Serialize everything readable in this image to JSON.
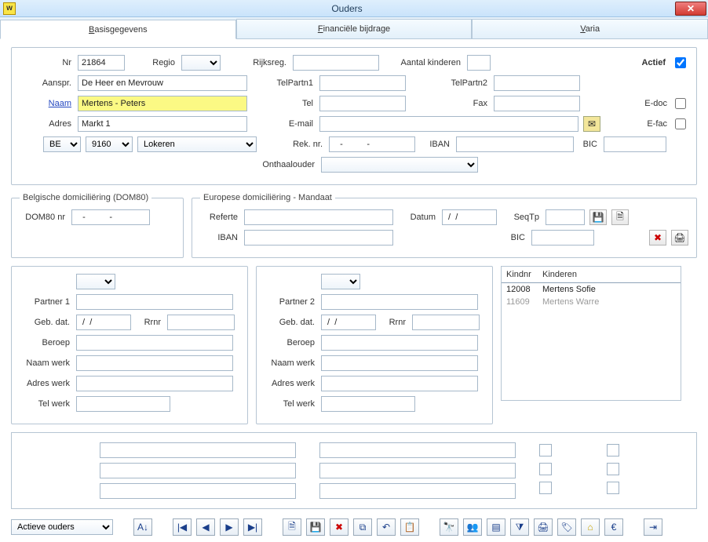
{
  "window": {
    "title": "Ouders",
    "icon_letter": "w"
  },
  "tabs": {
    "t1_pre": "B",
    "t1": "asisgegevens",
    "t2_pre": "F",
    "t2": "inanciële bijdrage",
    "t3_pre": "V",
    "t3": "aria"
  },
  "labels": {
    "nr": "Nr",
    "regio": "Regio",
    "rijksreg": "Rijksreg.",
    "aantal_kinderen": "Aantal kinderen",
    "actief": "Actief",
    "aanspr": "Aanspr.",
    "telpartn1": "TelPartn1",
    "telpartn2": "TelPartn2",
    "naam": "Naam",
    "tel": "Tel",
    "fax": "Fax",
    "adres": "Adres",
    "email": "E-mail",
    "edoc": "E-doc",
    "efac": "E-fac",
    "reknr": "Rek. nr.",
    "iban": "IBAN",
    "bic": "BIC",
    "onthaalouder": "Onthaalouder",
    "dom_fieldset": "Belgische domiciliëring (DOM80)",
    "dom80nr": "DOM80 nr",
    "eu_fieldset": "Europese domiciliëring - Mandaat",
    "referte": "Referte",
    "datum": "Datum",
    "seqtp": "SeqTp",
    "iban2": "IBAN",
    "bic2": "BIC",
    "partner1": "Partner 1",
    "partner2": "Partner 2",
    "gebdat": "Geb. dat.",
    "rrnr": "Rrnr",
    "beroep": "Beroep",
    "naamwerk": "Naam werk",
    "adreswerk": "Adres werk",
    "telwerk": "Tel werk",
    "kindnr": "Kindnr",
    "kinderen": "Kinderen"
  },
  "basis": {
    "nr": "21864",
    "regio": "",
    "rijksreg": "",
    "aantal_kinderen": "",
    "actief": true,
    "aanspr": "De Heer en Mevrouw",
    "telpartn1": "",
    "telpartn2": "",
    "naam": "Mertens - Peters",
    "tel": "",
    "fax": "",
    "adres": "Markt 1",
    "email": "",
    "edoc": false,
    "efac": false,
    "land": "BE",
    "postcode": "9160",
    "gemeente": "Lokeren",
    "reknr": "   -          -",
    "iban": "",
    "bic": "",
    "onthaalouder": ""
  },
  "dom80": {
    "nr": "   -          -"
  },
  "eu": {
    "referte": "",
    "datum": " /  / ",
    "seqtp": "",
    "iban": "",
    "bic": ""
  },
  "partner1": {
    "sel": "",
    "naam": "",
    "gebdat": " /  / ",
    "rrnr": "",
    "beroep": "",
    "naamwerk": "",
    "adreswerk": "",
    "telwerk": ""
  },
  "partner2": {
    "sel": "",
    "naam": "",
    "gebdat": " /  / ",
    "rrnr": "",
    "beroep": "",
    "naamwerk": "",
    "adreswerk": "",
    "telwerk": ""
  },
  "kinderen": [
    {
      "nr": "12008",
      "naam": "Mertens Sofie",
      "muted": false
    },
    {
      "nr": "11609",
      "naam": "Mertens Warre",
      "muted": true
    }
  ],
  "filter_combo": "Actieve ouders",
  "extra": {
    "col1": [
      "",
      "",
      ""
    ],
    "col2": [
      "",
      "",
      ""
    ]
  }
}
